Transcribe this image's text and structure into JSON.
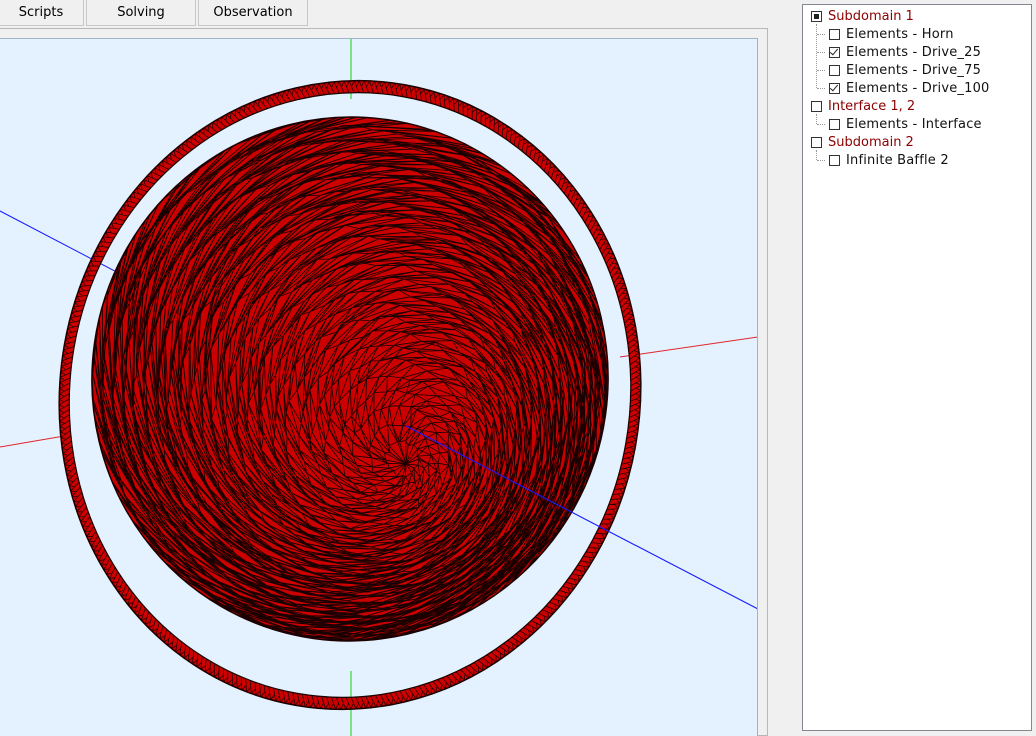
{
  "tabs": [
    {
      "label": "Scripts"
    },
    {
      "label": "Solving"
    },
    {
      "label": "Observation"
    }
  ],
  "tree": {
    "groups": [
      {
        "label": "Subdomain 1",
        "state": "indeterminate",
        "children": [
          {
            "label": "Elements - Horn",
            "checked": false
          },
          {
            "label": "Elements - Drive_25",
            "checked": true
          },
          {
            "label": "Elements - Drive_75",
            "checked": false
          },
          {
            "label": "Elements - Drive_100",
            "checked": true
          }
        ]
      },
      {
        "label": "Interface 1, 2",
        "state": "unchecked",
        "children": [
          {
            "label": "Elements - Interface",
            "checked": false
          }
        ]
      },
      {
        "label": "Subdomain 2",
        "state": "unchecked",
        "children": [
          {
            "label": "Infinite Baffle 2",
            "checked": false
          }
        ]
      }
    ]
  },
  "colors": {
    "viewport_background": "#e4f1fe",
    "mesh_fill": "#cc0000",
    "mesh_edges": "#1a0000",
    "axis_x": "#e0252b",
    "axis_y": "#35d935",
    "axis_z": "#1a1aff",
    "group_label": "#8b0000"
  }
}
